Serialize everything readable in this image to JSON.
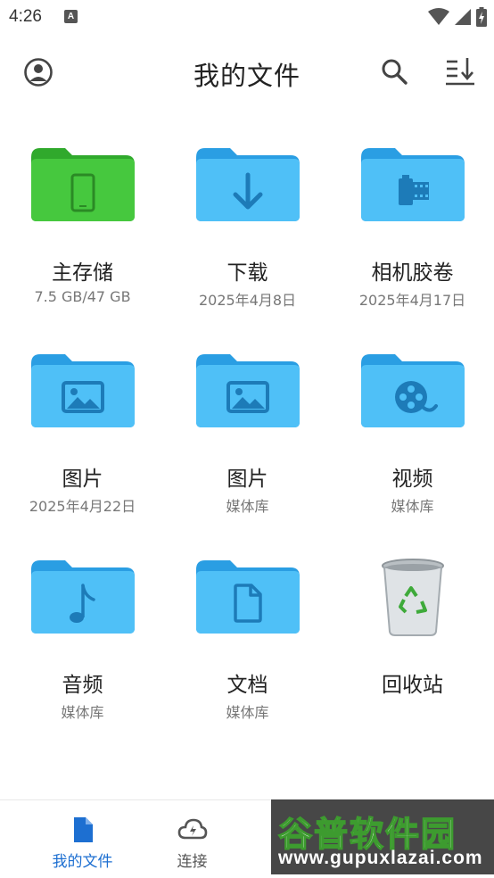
{
  "status_bar": {
    "time": "4:26",
    "notification_letter": "A"
  },
  "header": {
    "title": "我的文件",
    "account_icon": "account-circle-icon",
    "search_icon": "search-icon",
    "sort_icon": "sort-download-icon"
  },
  "folders": [
    {
      "name": "主存储",
      "sub": "7.5 GB/47 GB",
      "icon": "phone-folder-icon",
      "color": "#3ec23a"
    },
    {
      "name": "下载",
      "sub": "2025年4月8日",
      "icon": "download-folder-icon",
      "color": "#3fb5f5"
    },
    {
      "name": "相机胶卷",
      "sub": "2025年4月17日",
      "icon": "camera-roll-folder-icon",
      "color": "#3fb5f5"
    },
    {
      "name": "图片",
      "sub": "2025年4月22日",
      "icon": "image-folder-icon",
      "color": "#3fb5f5"
    },
    {
      "name": "图片",
      "sub": "媒体库",
      "icon": "image-folder-icon",
      "color": "#3fb5f5"
    },
    {
      "name": "视频",
      "sub": "媒体库",
      "icon": "video-folder-icon",
      "color": "#3fb5f5"
    },
    {
      "name": "音频",
      "sub": "媒体库",
      "icon": "music-folder-icon",
      "color": "#3fb5f5"
    },
    {
      "name": "文档",
      "sub": "媒体库",
      "icon": "document-folder-icon",
      "color": "#3fb5f5"
    },
    {
      "name": "回收站",
      "sub": "",
      "icon": "recycle-bin-icon",
      "color": "#9aa1a6"
    }
  ],
  "bottom_nav": [
    {
      "label": "我的文件",
      "icon": "file-icon",
      "active": true
    },
    {
      "label": "连接",
      "icon": "cloud-icon",
      "active": false
    }
  ],
  "watermark": {
    "title": "谷普软件园",
    "url": "www.gupuxlazai.com"
  },
  "colors": {
    "accent": "#1d6fd1",
    "folder_blue": "#3fb5f5",
    "folder_green": "#3ec23a"
  }
}
